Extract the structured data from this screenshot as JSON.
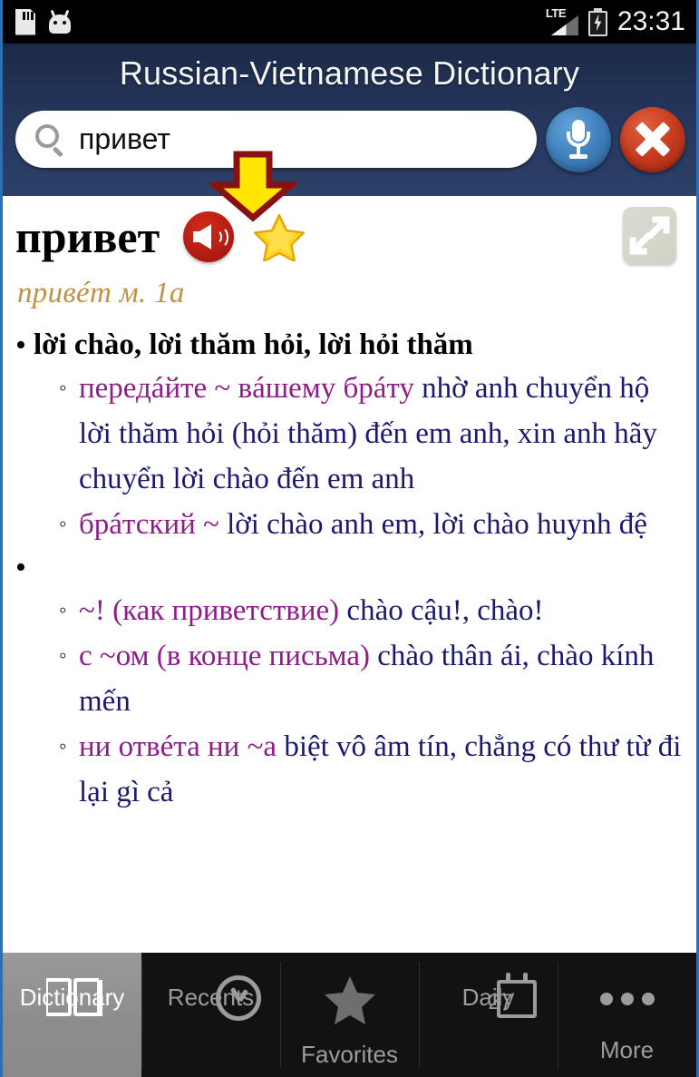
{
  "statusbar": {
    "time": "23:31",
    "network_label": "LTE",
    "icons": [
      "sd-card-icon",
      "android-robot-icon",
      "lte-signal-icon",
      "battery-charging-icon"
    ]
  },
  "appbar": {
    "title": "Russian-Vietnamese Dictionary"
  },
  "search": {
    "value": "привет",
    "placeholder": "",
    "search_icon": "search-icon",
    "mic_icon": "microphone-icon",
    "clear_icon": "clear-x-icon"
  },
  "annotation": {
    "type": "down-arrow-callout",
    "fill": "#ffe600",
    "stroke": "#8b1010"
  },
  "entry": {
    "headword": "привет",
    "speak_icon": "speaker-icon",
    "favorite_icon": "star-icon",
    "expand_icon": "expand-icon",
    "pronunciation": "привéт м. 1a",
    "senses": [
      {
        "bullet": "•",
        "gloss": "lời chào, lời thăm hỏi, lời hỏi thăm",
        "examples": [
          {
            "bullet": "◦",
            "ru": "передáйте ~ вáшему брáту",
            "vi": "nhờ anh chuyển hộ lời thăm hỏi (hỏi thăm) đến em anh, xin anh hãy chuyển lời chào đến em anh"
          },
          {
            "bullet": "◦",
            "ru": "брáтский ~",
            "vi": "lời chào anh em, lời chào huynh đệ"
          }
        ]
      },
      {
        "bullet": "•",
        "gloss": "",
        "examples": [
          {
            "bullet": "◦",
            "ru": "~! (как приветствие)",
            "vi": "chào cậu!, chào!"
          },
          {
            "bullet": "◦",
            "ru": "с ~ом (в конце письма)",
            "vi": "chào thân ái, chào kính mến"
          },
          {
            "bullet": "◦",
            "ru": "ни отвéта ни ~а",
            "vi": "biệt vô âm tín, chẳng có thư từ đi lại gì cả"
          }
        ]
      }
    ]
  },
  "tabbar": {
    "active_index": 0,
    "items": [
      {
        "label": "Dictionary",
        "icon": "book-icon"
      },
      {
        "label": "Recents",
        "icon": "clock-check-icon"
      },
      {
        "label": "Favorites",
        "icon": "star-icon"
      },
      {
        "label": "Daily",
        "icon": "calendar-icon",
        "badge": "27"
      },
      {
        "label": "More",
        "icon": "ellipsis-icon"
      }
    ]
  },
  "colors": {
    "header_navy": "#24355a",
    "russian_purple": "#8e1d8a",
    "vietnamese_navy": "#191970",
    "pronunciation_gold": "#bf9244",
    "speaker_red": "#b41d12",
    "mic_blue": "#3c7cb9",
    "clear_red": "#c3381c",
    "star_gold": "#ffd427"
  }
}
